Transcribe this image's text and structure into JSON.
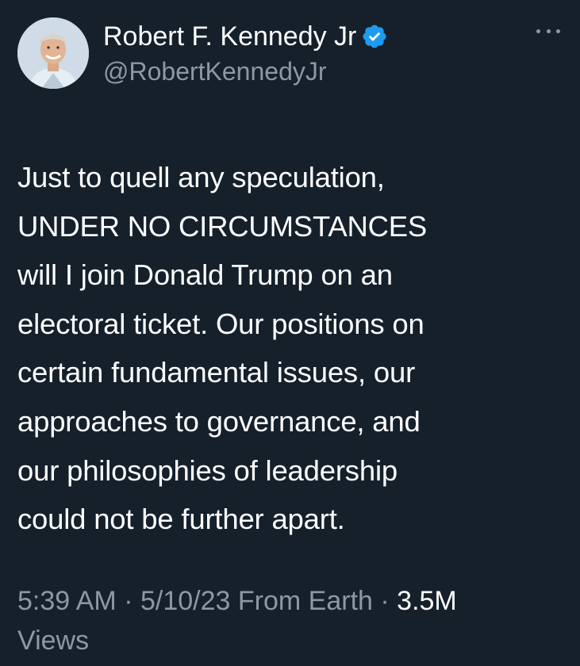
{
  "user": {
    "display_name": "Robert F. Kennedy Jr",
    "handle": "@RobertKennedyJr",
    "verified": true
  },
  "icons": {
    "verified": "verified-badge-icon",
    "more": "more-horizontal-icon"
  },
  "colors": {
    "background": "#15202b",
    "text": "#ffffff",
    "secondary_text": "#8b98a5",
    "verified_badge": "#1d9bf0"
  },
  "tweet": {
    "lines": [
      "Just to quell any speculation,",
      "UNDER NO CIRCUMSTANCES",
      "will I join Donald Trump on an",
      "electoral ticket. Our positions on",
      "certain fundamental issues, our",
      "approaches to governance, and",
      "our philosophies of leadership",
      "could not be further apart."
    ]
  },
  "meta": {
    "time": "5:39 AM",
    "separator": "·",
    "date": "5/10/23",
    "source": "From Earth",
    "views_count": "3.5M",
    "views_label": "Views"
  }
}
